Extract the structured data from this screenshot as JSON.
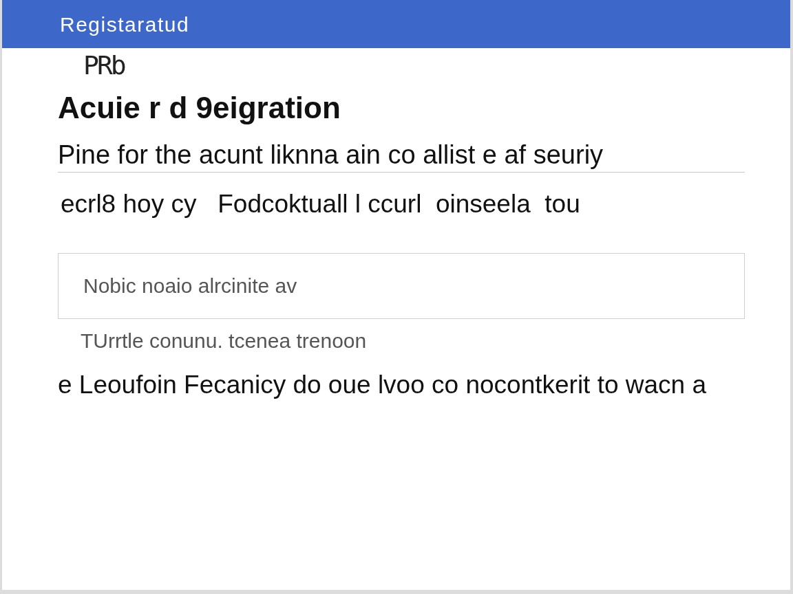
{
  "header": {
    "title": "Registaratud"
  },
  "label": "PRb",
  "heading": "Acuie r d 9eigration",
  "subheading": "Pine for the acunt liknna ain co allist e af seuriy",
  "notice": "ecrl8 hoy cy   Fodcoktuall l ccurl  oinseela  tou",
  "field": {
    "placeholder": "Nobic noaio alrcinite av"
  },
  "hint": "TUrrtle conunu. tcenea trenoon",
  "footer_text": "e Leoufoin Fecanicy do oue lvoo co nocontkerit to wacn a"
}
